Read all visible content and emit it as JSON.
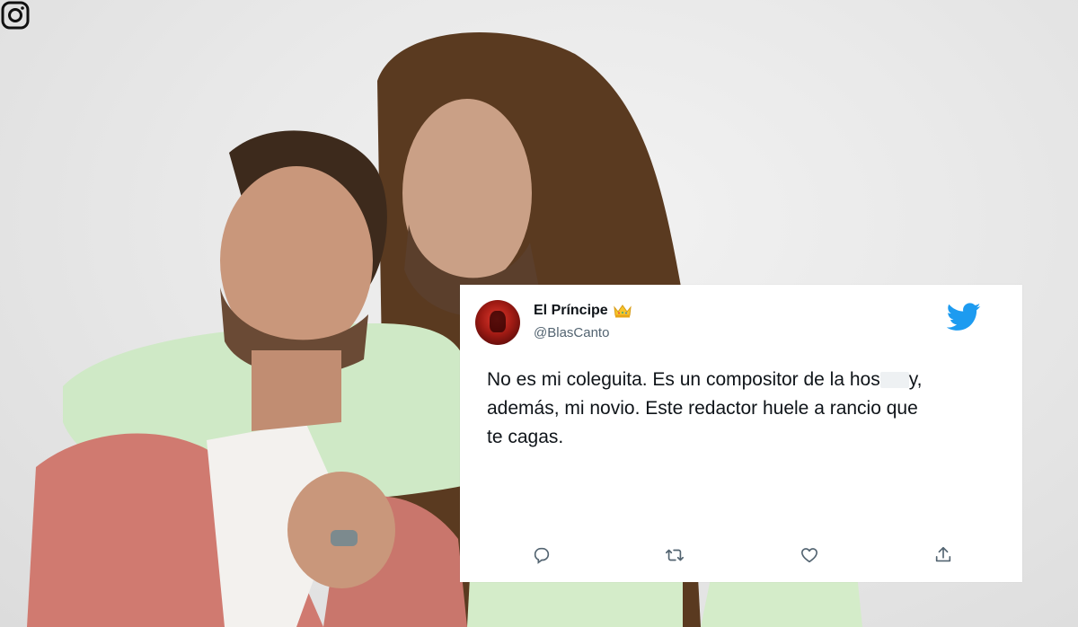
{
  "background": {
    "description_icon": "instagram-icon"
  },
  "tweet": {
    "display_name": "El Príncipe",
    "name_emoji": "crown-icon",
    "handle": "@BlasCanto",
    "text_line1": "No es mi coleguita. Es un compositor de la hos",
    "text_line1_end": "y,",
    "text_line2": "además, mi novio. Este redactor huele a rancio que",
    "text_line3": "te cagas.",
    "logo": "twitter-bird-icon",
    "actions": [
      "reply-icon",
      "retweet-icon",
      "like-icon",
      "share-icon"
    ]
  },
  "colors": {
    "twitter_blue": "#1d9bf0",
    "text": "#0f1419",
    "muted": "#536471"
  }
}
